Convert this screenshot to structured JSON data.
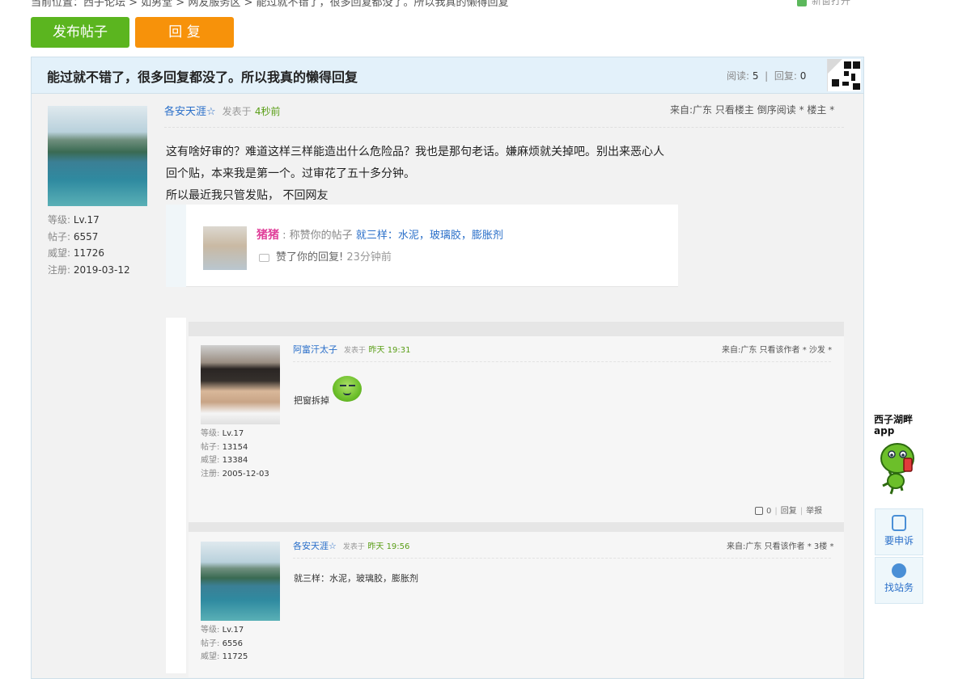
{
  "breadcrumb": "当前位置：西子论坛 > 如男堂 > 网友服务区 > 能过就不错了，很多回复都没了。所以我真的懒得回复",
  "new_window": "新窗打开",
  "buttons": {
    "new_post": "发布帖子",
    "reply": "回 复"
  },
  "thread": {
    "title": "能过就不错了，很多回复都没了。所以我真的懒得回复",
    "views_label": "阅读:",
    "views": "5",
    "replies_label": "回复:",
    "replies": "0"
  },
  "post": {
    "author": "各安天涯☆",
    "posted_label": "发表于",
    "time": "4秒前",
    "from": "来自:广东",
    "only_author": "只看楼主",
    "reverse": "倒序阅读",
    "floor": "* 楼主 *",
    "stats": {
      "level_label": "等级:",
      "level": "Lv.17",
      "posts_label": "帖子:",
      "posts": "6557",
      "prestige_label": "威望:",
      "prestige": "11726",
      "reg_label": "注册:",
      "reg": "2019-03-12"
    },
    "lines": [
      "这有啥好审的？难道这样三样能造出什么危险品？我也是那句老话。嫌麻烦就关掉吧。别出来恶心人",
      "回个贴，本来我是第一个。过审花了五十多分钟。",
      "所以最近我只管发贴， 不回网友"
    ]
  },
  "notification": {
    "user": "猪猪",
    "sep": ":",
    "action": "称赞你的帖子",
    "topic": "就三样：水泥，玻璃胶，膨胀剂",
    "liked": "赞了你的回复!",
    "time": "23分钟前"
  },
  "quotes": [
    {
      "author": "阿富汗太子",
      "posted_label": "发表于",
      "time": "昨天 19:31",
      "from": "来自:广东 只看该作者 * 沙发 *",
      "text": "把窗拆掉",
      "stats": {
        "level_label": "等级:",
        "level": "Lv.17",
        "posts_label": "帖子:",
        "posts": "13154",
        "prestige_label": "威望:",
        "prestige": "13384",
        "reg_label": "注册:",
        "reg": "2005-12-03"
      },
      "likes": "0",
      "reply": "回复",
      "report": "举报"
    },
    {
      "author": "各安天涯☆",
      "posted_label": "发表于",
      "time": "昨天 19:56",
      "from": "来自:广东 只看该作者 * 3楼 *",
      "text": "就三样：水泥，玻璃胶，膨胀剂",
      "stats": {
        "level_label": "等级:",
        "level": "Lv.17",
        "posts_label": "帖子:",
        "posts": "6556",
        "prestige_label": "威望:",
        "prestige": "11725"
      }
    }
  ],
  "sidebar": {
    "app_line1": "西子湖畔",
    "app_line2": "app",
    "appeal": "要申诉",
    "contact": "找站务"
  }
}
